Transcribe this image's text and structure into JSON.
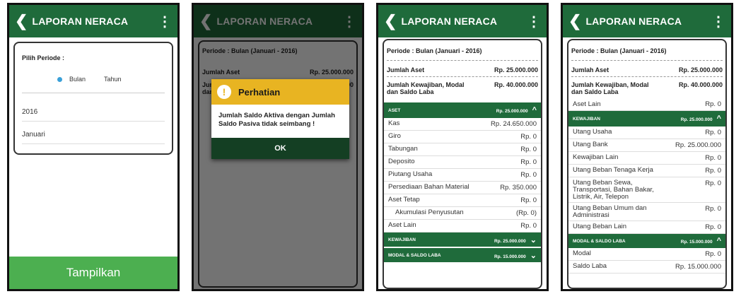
{
  "app": {
    "title": "LAPORAN NERACA"
  },
  "screen1": {
    "period_label": "Pilih Periode :",
    "radio_month": "Bulan",
    "radio_year": "Tahun",
    "year_value": "2016",
    "month_value": "Januari",
    "submit": "Tampilkan"
  },
  "summary": {
    "periode": "Periode : Bulan (Januari - 2016)",
    "aset_label": "Jumlah Aset",
    "aset_value": "Rp. 25.000.000",
    "kewajiban_label": "Jumlah Kewajiban, Modal dan Saldo Laba",
    "kewajiban_value": "Rp. 40.000.000"
  },
  "dialog": {
    "title": "Perhatian",
    "message": "Jumlah Saldo Aktiva dengan Jumlah Saldo Pasiva tidak seimbang !",
    "ok": "OK"
  },
  "screen3": {
    "aset_header": "ASET",
    "aset_total": "Rp. 25.000.000",
    "aset_items": [
      {
        "label": "Kas",
        "value": "Rp. 24.650.000"
      },
      {
        "label": "Giro",
        "value": "Rp. 0"
      },
      {
        "label": "Tabungan",
        "value": "Rp. 0"
      },
      {
        "label": "Deposito",
        "value": "Rp. 0"
      },
      {
        "label": "Piutang Usaha",
        "value": "Rp. 0"
      },
      {
        "label": "Persediaan Bahan Material",
        "value": "Rp. 350.000"
      },
      {
        "label": "Aset Tetap",
        "value": "Rp. 0"
      },
      {
        "label": "Akumulasi Penyusutan",
        "value": "(Rp. 0)"
      },
      {
        "label": "Aset Lain",
        "value": "Rp. 0"
      }
    ],
    "kewajiban_header": "KEWAJIBAN",
    "kewajiban_total": "Rp. 25.000.000",
    "modal_header": "MODAL & SALDO LABA",
    "modal_total": "Rp. 15.000.000"
  },
  "screen4": {
    "aset_lain": {
      "label": "Aset Lain",
      "value": "Rp. 0"
    },
    "kewajiban_header": "KEWAJIBAN",
    "kewajiban_total": "Rp. 25.000.000",
    "kewajiban_items": [
      {
        "label": "Utang Usaha",
        "value": "Rp. 0"
      },
      {
        "label": "Utang Bank",
        "value": "Rp. 25.000.000"
      },
      {
        "label": "Kewajiban Lain",
        "value": "Rp. 0"
      },
      {
        "label": "Utang Beban Tenaga Kerja",
        "value": "Rp. 0"
      },
      {
        "label": "Utang Beban Sewa, Transportasi, Bahan Bakar, Listrik, Air, Telepon",
        "value": "Rp. 0"
      },
      {
        "label": "Utang Beban Umum dan Administrasi",
        "value": "Rp. 0"
      },
      {
        "label": "Utang Beban Lain",
        "value": "Rp. 0"
      }
    ],
    "modal_header": "MODAL & SALDO LABA",
    "modal_total": "Rp. 15.000.000",
    "modal_items": [
      {
        "label": "Modal",
        "value": "Rp. 0"
      },
      {
        "label": "Saldo Laba",
        "value": "Rp. 15.000.000"
      }
    ]
  },
  "colors": {
    "brand_green": "#1f6b3b",
    "button_green": "#4caf50",
    "warning": "#e8b422"
  }
}
